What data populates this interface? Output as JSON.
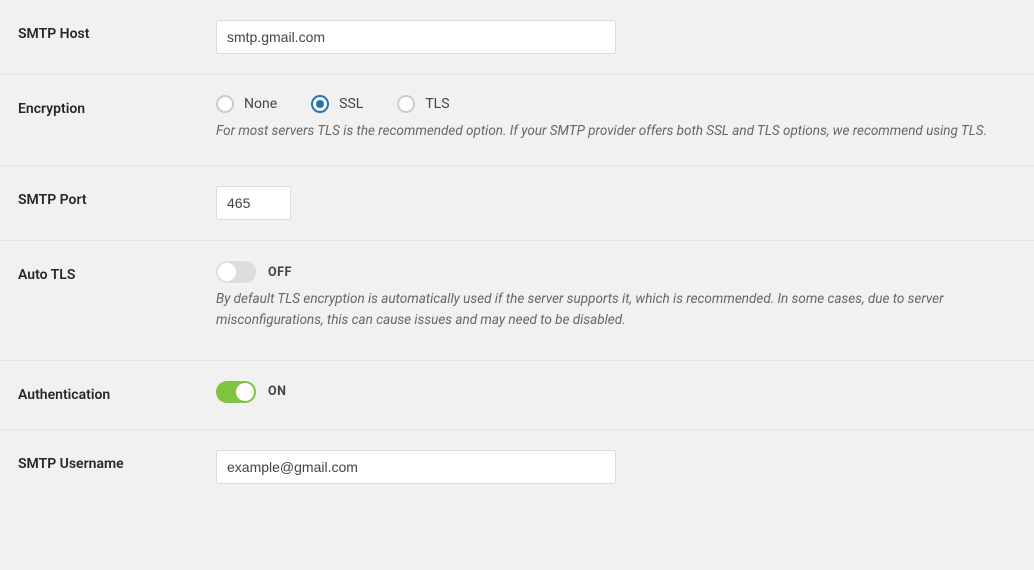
{
  "smtp_host": {
    "label": "SMTP Host",
    "value": "smtp.gmail.com"
  },
  "encryption": {
    "label": "Encryption",
    "selected": "ssl",
    "options": {
      "none": "None",
      "ssl": "SSL",
      "tls": "TLS"
    },
    "desc": "For most servers TLS is the recommended option. If your SMTP provider offers both SSL and TLS options, we recommend using TLS."
  },
  "smtp_port": {
    "label": "SMTP Port",
    "value": "465"
  },
  "auto_tls": {
    "label": "Auto TLS",
    "state": "OFF",
    "desc": "By default TLS encryption is automatically used if the server supports it, which is recommended. In some cases, due to server misconfigurations, this can cause issues and may need to be disabled."
  },
  "authentication": {
    "label": "Authentication",
    "state": "ON"
  },
  "smtp_username": {
    "label": "SMTP Username",
    "value": "example@gmail.com"
  }
}
